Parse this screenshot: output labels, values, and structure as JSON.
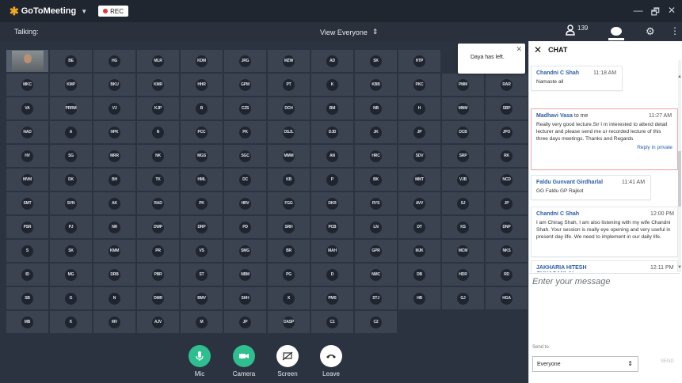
{
  "titlebar": {
    "app_name": "GoToMeeting",
    "rec_label": "REC",
    "minimize": "—",
    "maximize": "🗗",
    "close": "✕"
  },
  "topbar": {
    "talking": "Talking:",
    "view": "View Everyone",
    "attendee_count": "139",
    "more": "⋮"
  },
  "grid": {
    "rows": [
      [
        "",
        "BE",
        "HG",
        "MLR",
        "KDM",
        "JRG",
        "MZW",
        "AD",
        "SK",
        "HTP",
        "",
        ""
      ],
      [
        "MKC",
        "KMP",
        "BKU",
        "KMR",
        "HHR",
        "GPM",
        "PT",
        "K",
        "KBB",
        "PKC",
        "PMM",
        "RAR"
      ],
      [
        "VA",
        "PRRM",
        "VJ",
        "KJP",
        "B",
        "CZS",
        "DCH",
        "BM",
        "NB",
        "H",
        "MNM",
        "SBP"
      ],
      [
        "NAD",
        "A",
        "HPK",
        "N",
        "PCC",
        "PK",
        "DSJL",
        "DJD",
        "JK",
        "JP",
        "DCB",
        "JPO"
      ],
      [
        "HV",
        "SG",
        "MRR",
        "NK",
        "MGS",
        "SGC",
        "MMM",
        "AN",
        "HRC",
        "SDV",
        "SRP",
        "RK"
      ],
      [
        "MVM",
        "DK",
        "BH",
        "TK",
        "HML",
        "DC",
        "KB",
        "P",
        "BK",
        "MMT",
        "VJB",
        "NCD"
      ],
      [
        "SMT",
        "SVN",
        "AK",
        "RAD",
        "PK",
        "HRV",
        "FGG",
        "DKR",
        "RYS",
        "AVV",
        "SJ",
        "JP"
      ],
      [
        "PSR",
        "PJ",
        "NR",
        "DWP",
        "DRP",
        "PD",
        "SRH",
        "PCB",
        "LN",
        "DT",
        "KS",
        "DNP"
      ],
      [
        "S",
        "SK",
        "KMM",
        "PR",
        "VS",
        "SMG",
        "BR",
        "MAH",
        "GPR",
        "MJK",
        "MCM",
        "NKS"
      ],
      [
        "ID",
        "MG",
        "DRB",
        "PBR",
        "ST",
        "NBM",
        "PG",
        "D",
        "NMC",
        "DB",
        "HDR",
        "RD"
      ],
      [
        "SB",
        "G",
        "N",
        "DMR",
        "BMV",
        "SHH",
        "X",
        "PMS",
        "STJ",
        "HB",
        "GJ",
        "HGA"
      ],
      [
        "MB",
        "K",
        "MV",
        "AJV",
        "M",
        "JP",
        "DASP",
        "C1",
        "C2",
        "",
        "",
        ""
      ]
    ]
  },
  "toast": {
    "message": "Daya has left.",
    "close": "✕"
  },
  "controls": {
    "mic": "Mic",
    "camera": "Camera",
    "screen": "Screen",
    "leave": "Leave"
  },
  "chat": {
    "close": "✕",
    "title": "CHAT",
    "messages": [
      {
        "sender": "Chandni C Shah",
        "to": "",
        "time": "11:18 AM",
        "text": "Namaste all",
        "reply": ""
      },
      {
        "sender": "Madhavi Vasa",
        "to": "to me",
        "time": "11:27 AM",
        "text": "Really very good lecture.Sir I m interested to attend detail lecturer and please send me ur recorded lecture of this three days meetings. Thanks and Regards",
        "reply": "Reply in private"
      },
      {
        "sender": "Faldu Gunvant Girdharlal",
        "to": "",
        "time": "11:41 AM",
        "text": "GG Faldu GP Rajkot",
        "reply": ""
      },
      {
        "sender": "Chandni C Shah",
        "to": "",
        "time": "12:00 PM",
        "text": "I am Chirag Shah, I am also listening with my wife Chandni Shah. Your session is really eye opening and very useful in present day life. We need to implement in our daily life.",
        "reply": ""
      },
      {
        "sender": "JAKHARIA HITESH CHHAGANLAL",
        "to": "",
        "time": "12:11 PM",
        "text": "",
        "reply": ""
      }
    ],
    "input_placeholder": "Enter your message",
    "send_to_label": "Send to",
    "send_to_value": "Everyone",
    "send_button": "SEND"
  }
}
